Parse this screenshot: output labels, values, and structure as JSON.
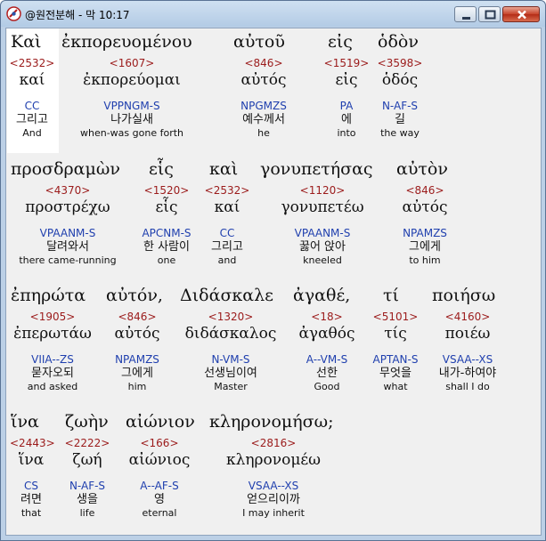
{
  "window": {
    "title": "@원전분해 - 막 10:17"
  },
  "lines": [
    {
      "surface": [
        "Καὶ",
        "ἐκπορευομένου",
        "αὐτοῦ",
        "εἰς",
        "ὁδὸν"
      ],
      "words": [
        {
          "num": "<2532>",
          "lemma": "καί",
          "parse": "CC",
          "korean": "그리고",
          "english": "And"
        },
        {
          "num": "<1607>",
          "lemma": "ἐκπορεύομαι",
          "parse": "VPPNGM-S",
          "korean": "나가실새",
          "english": "when-was gone forth"
        },
        {
          "num": "<846>",
          "lemma": "αὐτός",
          "parse": "NPGMZS",
          "korean": "예수께서",
          "english": "he"
        },
        {
          "num": "<1519>",
          "lemma": "εἰς",
          "parse": "PA",
          "korean": "에",
          "english": "into"
        },
        {
          "num": "<3598>",
          "lemma": "ὁδός",
          "parse": "N-AF-S",
          "korean": "길",
          "english": "the way"
        }
      ]
    },
    {
      "surface": [
        "προσδραμὼν",
        "εἷς",
        "καὶ",
        "γονυπετήσας",
        "αὐτὸν"
      ],
      "words": [
        {
          "num": "<4370>",
          "lemma": "προστρέχω",
          "parse": "VPAANM-S",
          "korean": "달려와서",
          "english": "there came-running"
        },
        {
          "num": "<1520>",
          "lemma": "εἷς",
          "parse": "APCNM-S",
          "korean": "한 사람이",
          "english": "one"
        },
        {
          "num": "<2532>",
          "lemma": "καί",
          "parse": "CC",
          "korean": "그리고",
          "english": "and"
        },
        {
          "num": "<1120>",
          "lemma": "γονυπετέω",
          "parse": "VPAANM-S",
          "korean": "꿇어 앉아",
          "english": "kneeled"
        },
        {
          "num": "<846>",
          "lemma": "αὐτός",
          "parse": "NPAMZS",
          "korean": "그에게",
          "english": "to him"
        }
      ]
    },
    {
      "surface": [
        "ἐπηρώτα",
        "αὐτόν,",
        "Διδάσκαλε",
        "ἀγαθέ,",
        "τί",
        "ποιήσω"
      ],
      "words": [
        {
          "num": "<1905>",
          "lemma": "ἐπερωτάω",
          "parse": "VIIA--ZS",
          "korean": "묻자오되",
          "english": "and asked"
        },
        {
          "num": "<846>",
          "lemma": "αὐτός",
          "parse": "NPAMZS",
          "korean": "그에게",
          "english": "him"
        },
        {
          "num": "<1320>",
          "lemma": "διδάσκαλος",
          "parse": "N-VM-S",
          "korean": "선생님이여",
          "english": "Master"
        },
        {
          "num": "<18>",
          "lemma": "ἀγαθός",
          "parse": "A--VM-S",
          "korean": "선한",
          "english": "Good"
        },
        {
          "num": "<5101>",
          "lemma": "τίς",
          "parse": "APTAN-S",
          "korean": "무엇을",
          "english": "what"
        },
        {
          "num": "<4160>",
          "lemma": "ποιέω",
          "parse": "VSAA--XS",
          "korean": "내가-하여야",
          "english": "shall I do"
        }
      ]
    },
    {
      "surface": [
        "ἵνα",
        "ζωὴν",
        "αἰώνιον",
        "κληρονομήσω;"
      ],
      "words": [
        {
          "num": "<2443>",
          "lemma": "ἵνα",
          "parse": "CS",
          "korean": "려면",
          "english": "that"
        },
        {
          "num": "<2222>",
          "lemma": "ζωή",
          "parse": "N-AF-S",
          "korean": "생을",
          "english": "life"
        },
        {
          "num": "<166>",
          "lemma": "αἰώνιος",
          "parse": "A--AF-S",
          "korean": "영",
          "english": "eternal"
        },
        {
          "num": "<2816>",
          "lemma": "κληρονομέω",
          "parse": "VSAA--XS",
          "korean": "얻으리이까",
          "english": "I may inherit"
        }
      ]
    }
  ]
}
